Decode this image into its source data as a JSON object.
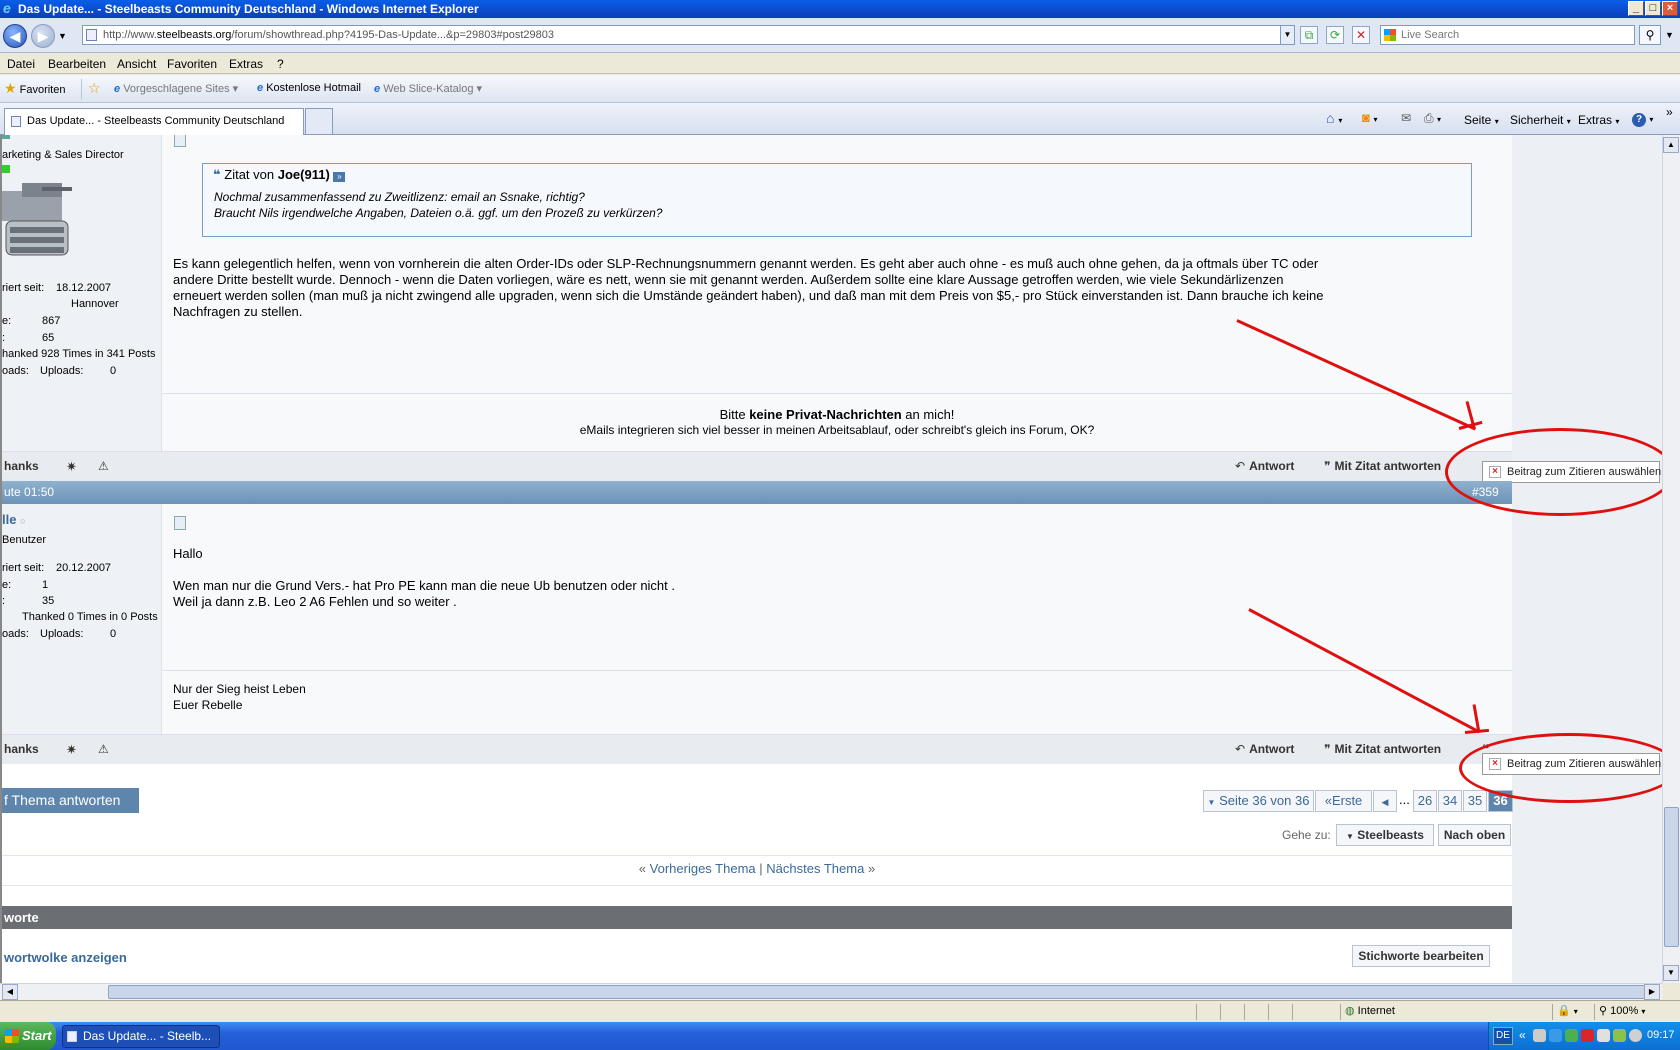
{
  "window": {
    "title": "Das Update... - Steelbeasts Community Deutschland - Windows Internet Explorer"
  },
  "address": {
    "url_prefix": "http://www.",
    "url_domain": "steelbeasts.org",
    "url_rest": "/forum/showthread.php?4195-Das-Update...&p=29803#post29803"
  },
  "search": {
    "placeholder": "Live Search"
  },
  "menu": [
    "Datei",
    "Bearbeiten",
    "Ansicht",
    "Favoriten",
    "Extras",
    "?"
  ],
  "favbar": {
    "favoriten": "Favoriten",
    "vorgeschlagene": "Vorgeschlagene Sites",
    "hotmail": "Kostenlose Hotmail",
    "webslice": "Web Slice-Katalog"
  },
  "tab": {
    "title": "Das Update... - Steelbeasts Community Deutschland"
  },
  "commandbar": {
    "seite": "Seite",
    "sicherheit": "Sicherheit",
    "extras": "Extras"
  },
  "post1": {
    "user_title": "arketing & Sales Director",
    "registered_label": "riert seit:",
    "registered": "18.12.2007",
    "location": "Hannover",
    "posts_label": "e:",
    "posts": "867",
    "other_label": ":",
    "other": "65",
    "thanked": "hanked 928 Times in 341 Posts",
    "uploads_label": "oads:",
    "uploads_label2": "Uploads:",
    "uploads": "0",
    "quote_prefix": "Zitat von",
    "quote_author": "Joe(911)",
    "quote_line1": "Nochmal zusammenfassend zu Zweitlizenz: email an Ssnake, richtig?",
    "quote_line2": "Braucht Nils irgendwelche Angaben, Dateien o.ä. ggf. um den Prozeß zu verkürzen?",
    "body_line1": "Es kann gelegentlich helfen, wenn von vornherein die alten Order-IDs oder SLP-Rechnungsnummern genannt werden. Es geht aber auch ohne - es muß auch ohne gehen, da ja oftmals über TC oder",
    "body_line2": "andere Dritte bestellt wurde. Dennoch - wenn die Daten vorliegen, wäre es nett, wenn sie mit genannt werden. Außerdem sollte eine klare Aussage getroffen werden, wie viele Sekundärlizenzen",
    "body_line3": "erneuert werden sollen (man muß ja nicht zwingend alle upgraden, wenn sich die Umstände geändert haben), und daß man mit dem Preis von $5,- pro Stück einverstanden ist. Dann brauche ich keine",
    "body_line4": "Nachfragen zu stellen.",
    "sig_pre": "Bitte",
    "sig_bold": "keine Privat-Nachrichten",
    "sig_post": "an mich!",
    "sig_line2": "eMails integrieren sich viel besser in meinen Arbeitsablauf, oder schreibt's gleich ins Forum, OK?"
  },
  "footer_actions": {
    "thanks": "hanks",
    "reply": "Antwort",
    "quote_reply": "Mit Zitat antworten",
    "select_quote": "Beitrag zum Zitieren auswählen"
  },
  "post2_header": {
    "date": "ute 01:50",
    "number": "#359"
  },
  "post2": {
    "username": "lle",
    "user_title": "Benutzer",
    "registered_label": "riert seit:",
    "registered": "20.12.2007",
    "posts_label": "e:",
    "posts": "1",
    "other_label": ":",
    "other": "35",
    "thanked": "Thanked 0 Times in 0 Posts",
    "uploads_label": "oads:",
    "uploads_label2": "Uploads:",
    "uploads": "0",
    "body_line1": "Hallo",
    "body_line2": "Wen man nur die Grund Vers.- hat Pro PE kann man die neue Ub benutzen oder nicht .",
    "body_line3": "Weil ja dann z.B. Leo 2 A6 Fehlen und so weiter .",
    "sig_line1": "Nur der Sieg heist Leben",
    "sig_line2": "Euer Rebelle"
  },
  "bottom": {
    "reply_thread": "f Thema antworten",
    "page_info": "Seite 36 von 36",
    "first": "Erste",
    "ellipsis": "...",
    "pages": [
      "26",
      "34",
      "35"
    ],
    "current_page": "36",
    "goto_label": "Gehe zu:",
    "goto_target": "Steelbeasts",
    "top": "Nach oben",
    "prev_thread": "Vorheriges Thema",
    "next_thread": "Nächstes Thema",
    "sep_left": "«",
    "sep_mid": "|",
    "sep_right": "»",
    "tags_header": "worte",
    "tagcloud": "wortwolke anzeigen",
    "edit_tags": "Stichworte bearbeiten"
  },
  "status": {
    "zone": "Internet",
    "zoom": "100%"
  },
  "taskbar": {
    "start": "Start",
    "item": "Das Update... - Steelb...",
    "lang": "DE",
    "clock": "09:17"
  }
}
